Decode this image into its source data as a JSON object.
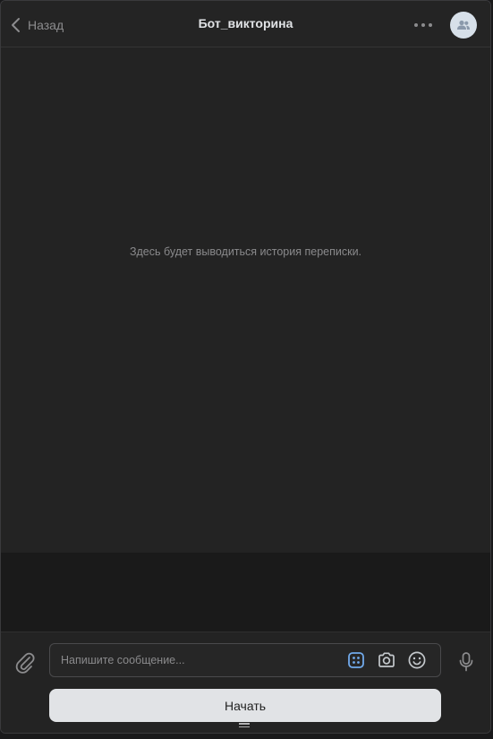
{
  "header": {
    "back_label": "Назад",
    "title": "Бот_викторина",
    "more_icon": "more-horizontal-icon",
    "avatar_icon": "users-icon"
  },
  "history": {
    "placeholder_text": "Здесь будет выводиться история переписки."
  },
  "composer": {
    "attach_icon": "paperclip-icon",
    "input_placeholder": "Напишите сообщение...",
    "input_value": "",
    "keyboard_icon": "bot-keyboard-icon",
    "camera_icon": "camera-icon",
    "emoji_icon": "smile-icon",
    "mic_icon": "microphone-icon",
    "start_button_label": "Начать"
  },
  "colors": {
    "background": "#222222",
    "header_bg": "#242424",
    "text_primary": "#e1e3e6",
    "text_secondary": "#8a8a8c",
    "accent_blue": "#71aaeb",
    "button_bg": "#e1e3e6"
  }
}
